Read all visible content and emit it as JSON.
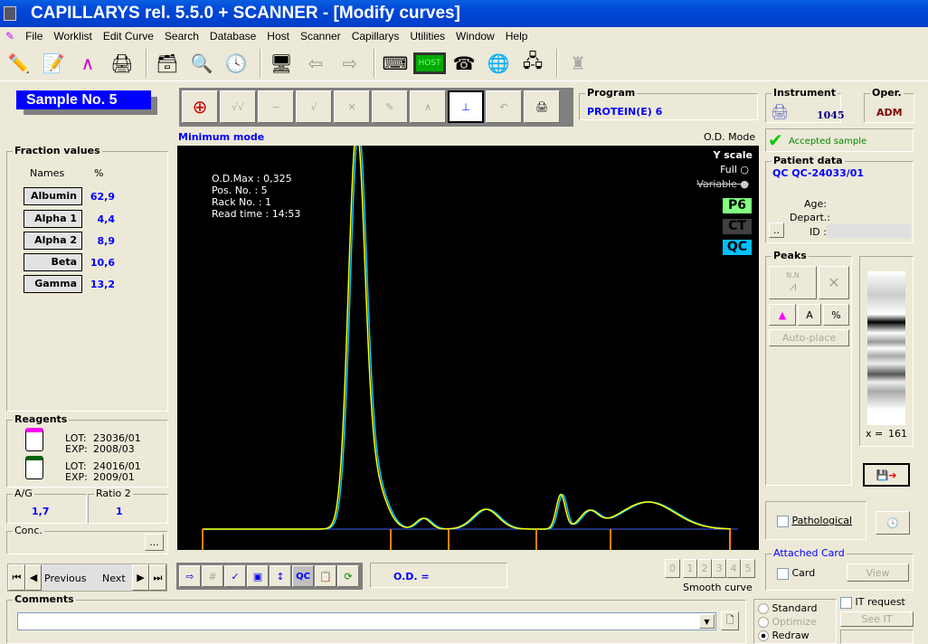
{
  "window": {
    "title": "CAPILLARYS rel. 5.5.0 + SCANNER - [Modify curves]"
  },
  "menu": [
    "File",
    "Worklist",
    "Edit Curve",
    "Search",
    "Database",
    "Host",
    "Scanner",
    "Capillarys",
    "Utilities",
    "Window",
    "Help"
  ],
  "toolbar_icons": [
    "edit-pencil",
    "notes",
    "curve-edit",
    "printer-scanner",
    "card-file",
    "magnifier",
    "clock",
    "scanner-monitor",
    "arrow-left",
    "arrow-right",
    "keypad",
    "host-monitor",
    "network-phone",
    "globe-device",
    "network",
    "chess-piece"
  ],
  "toolbar_host_label": "HOST",
  "sample": {
    "label": "Sample No.  5"
  },
  "fractions": {
    "title": "Fraction values",
    "col_names": "Names",
    "col_pct": "%",
    "items": [
      {
        "name": "Albumin",
        "value": "62,9"
      },
      {
        "name": "Alpha 1",
        "value": "4,4"
      },
      {
        "name": "Alpha 2",
        "value": "8,9"
      },
      {
        "name": "Beta",
        "value": "10,6"
      },
      {
        "name": "Gamma",
        "value": "13,2"
      }
    ]
  },
  "reagents": {
    "title": "Reagents",
    "items": [
      {
        "lot_label": "LOT:",
        "lot": "23036/01",
        "exp_label": "EXP:",
        "exp": "2008/03",
        "cap_color": "#ff00ff"
      },
      {
        "lot_label": "LOT:",
        "lot": "24016/01",
        "exp_label": "EXP:",
        "exp": "2009/01",
        "cap_color": "#006400"
      }
    ]
  },
  "ag": {
    "label": "A/G",
    "value": "1,7"
  },
  "ratio2": {
    "label": "Ratio 2",
    "value": "1"
  },
  "conc": {
    "label": "Conc.",
    "button": "..."
  },
  "nav": {
    "previous": "Previous",
    "next": "Next"
  },
  "program": {
    "label": "Program",
    "value": "PROTEIN(E) 6"
  },
  "graph": {
    "mode_left": "Minimum mode",
    "mode_right": "O.D. Mode",
    "info": [
      "O.D.Max : 0,325",
      "Pos. No.   : 5",
      "Rack No.  : 1",
      "Read time : 14:53"
    ],
    "yscale": "Y scale",
    "full": "Full",
    "variable": "Variable",
    "tags": [
      {
        "label": "P6",
        "color": "#80ff80"
      },
      {
        "label": "CT",
        "color": "#404040"
      },
      {
        "label": "QC",
        "color": "#00c0ff"
      }
    ],
    "curve_colors": {
      "main": "#ffff00",
      "ref": "#00ccff",
      "baseline": "#4060ff",
      "separator": "#ff8000"
    }
  },
  "od": {
    "label": "O.D. ="
  },
  "smooth": {
    "label": "Smooth curve",
    "options": [
      "0",
      "1",
      "2",
      "3",
      "4",
      "5"
    ]
  },
  "instrument": {
    "label": "Instrument",
    "value": "1045"
  },
  "operator": {
    "label": "Oper.",
    "value": "ADM"
  },
  "status": {
    "text": "Accepted sample"
  },
  "patient": {
    "label": "Patient data",
    "id_text": "QC QC-24033/01",
    "age": "Age:",
    "depart": "Depart.:",
    "id": "ID :",
    "button": ".."
  },
  "peaks": {
    "label": "Peaks",
    "nn": "N.N",
    "a": "A",
    "pct": "%",
    "autoplace": "Auto-place"
  },
  "gel": {
    "x_label": "x =",
    "x_value": "161"
  },
  "pathological": {
    "label": "Pathological"
  },
  "attached": {
    "label": "Attached Card",
    "card": "Card",
    "view": "View"
  },
  "comments": {
    "label": "Comments",
    "value": ""
  },
  "draw_mode": {
    "options": [
      "Standard",
      "Optimize",
      "Redraw"
    ],
    "selected": "Redraw"
  },
  "it": {
    "request": "IT request",
    "see": "See IT"
  }
}
